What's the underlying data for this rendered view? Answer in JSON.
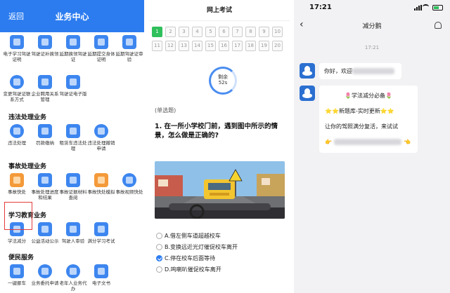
{
  "panel1": {
    "back_label": "返回",
    "title": "业务中心",
    "top_row": [
      "电子学习驾驶证明",
      "驾驶证补换领",
      "延期换领驾驶证",
      "延期提交身体证明",
      "延期驾驶证审验"
    ],
    "second_row": [
      "变更驾驶证联系方式",
      "企业聘用关系管理",
      "驾驶证电子版"
    ],
    "sections": [
      {
        "title": "违法处理业务",
        "items": [
          "违法处理",
          "罚款缴纳",
          "租赁车违法处理",
          "违法处理撤销申请"
        ]
      },
      {
        "title": "事故处理业务",
        "items": [
          "事故快处",
          "事故处理进度和结果",
          "事故证据材料查阅",
          "事故快处模拟",
          "事故视频快处"
        ]
      },
      {
        "title": "学习教育业务",
        "items": [
          "学法减分",
          "公益活动公示",
          "驾驶人审验",
          "满分学习考试"
        ]
      },
      {
        "title": "便民服务",
        "items": [
          "一键挪车",
          "业务委托申请",
          "老年人业务代办",
          "电子文书"
        ]
      }
    ]
  },
  "panel2": {
    "title": "网上考试",
    "questions_row1": [
      "1",
      "2",
      "3",
      "4",
      "5",
      "6",
      "7",
      "8",
      "9",
      "10"
    ],
    "questions_row2": [
      "11",
      "12",
      "13",
      "14",
      "15",
      "16",
      "17",
      "18",
      "19",
      "20"
    ],
    "timer_label": "剩余",
    "timer_value": "52s",
    "question_type": "(单选题)",
    "question_text": "1. 在一所小学校门前，遇到图中所示的情景，怎么做是正确的?",
    "options": [
      {
        "text": "A.借左侧车道超越校车",
        "checked": false
      },
      {
        "text": "B.变换远近光灯催促校车离开",
        "checked": false
      },
      {
        "text": "C.停在校车后面等待",
        "checked": true
      },
      {
        "text": "D.鸣喇叭催促校车离开",
        "checked": false
      }
    ]
  },
  "panel3": {
    "time": "17:21",
    "title": "减分鹅",
    "timestamp": "17:21",
    "msg1_text": "你好，欢迎",
    "msg2_line1": "🌷学法减分必备🌷",
    "msg2_line2": "⭐⭐新题库-实时更新⭐⭐",
    "msg2_line3": "让你的驾照满分复活，来试试",
    "msg2_line4_left": "👉",
    "msg2_line4_right": "👈"
  },
  "colors": {
    "header_blue": "#2c7cf0",
    "selected_border": "#e23b3b",
    "answer_green": "#2fbf5b"
  }
}
